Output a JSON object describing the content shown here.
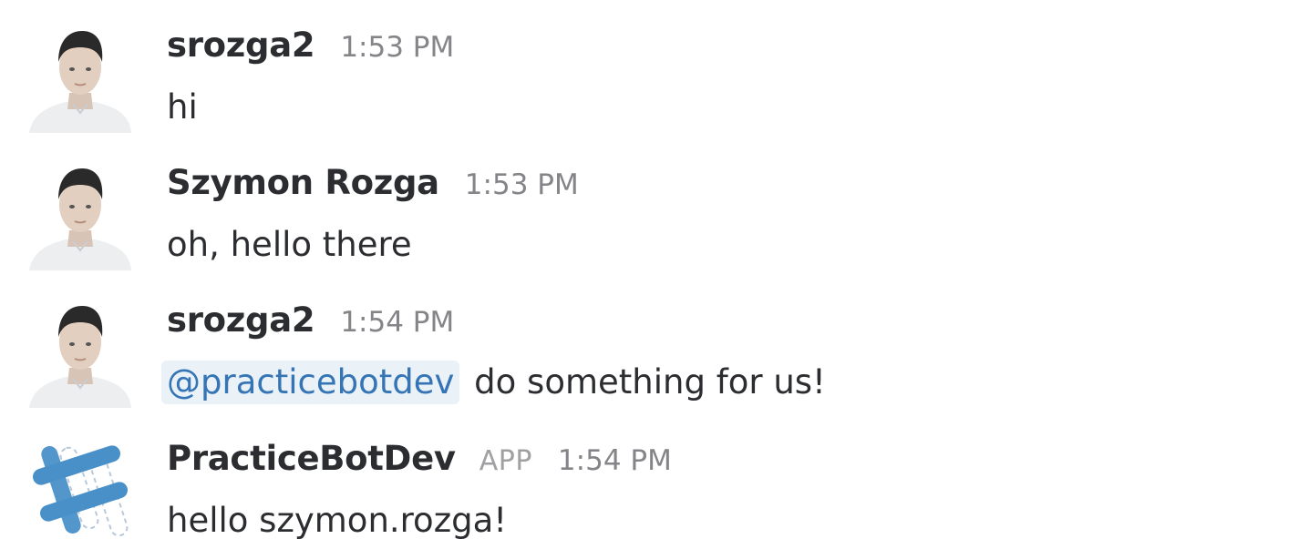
{
  "messages": [
    {
      "sender": "srozga2",
      "time": "1:53 PM",
      "text": "hi",
      "avatar": "user-photo-icon"
    },
    {
      "sender": "Szymon Rozga",
      "time": "1:53 PM",
      "text": "oh, hello there",
      "avatar": "user-photo-icon"
    },
    {
      "sender": "srozga2",
      "time": "1:54 PM",
      "mention": "@practicebotdev",
      "text": "do something for us!",
      "avatar": "user-photo-icon"
    },
    {
      "sender": "PracticeBotDev",
      "badge": "APP",
      "time": "1:54 PM",
      "text": "hello szymon.rozga!",
      "avatar": "slack-hash-logo-icon"
    }
  ],
  "colors": {
    "text": "#2c2d30",
    "timestamp": "#858589",
    "mention_text": "#3574b5",
    "mention_bg": "#eaf2f8",
    "bot_logo": "#4a90c8"
  }
}
